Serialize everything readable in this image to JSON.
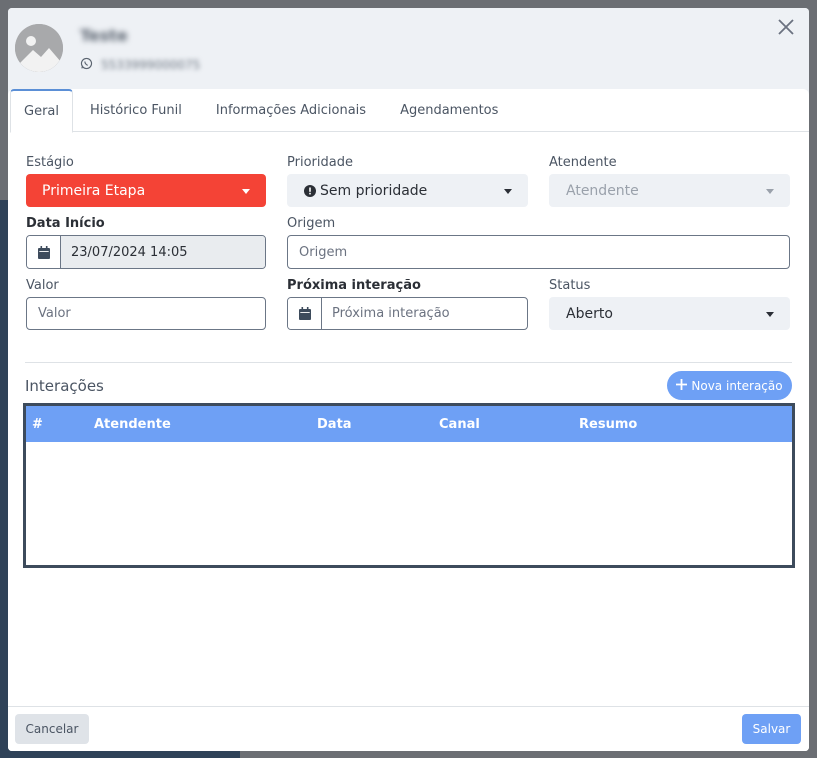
{
  "contact": {
    "name": "Teste",
    "phone": "5533999000075"
  },
  "tabs": [
    {
      "label": "Geral",
      "active": true
    },
    {
      "label": "Histórico Funil",
      "active": false
    },
    {
      "label": "Informações Adicionais",
      "active": false
    },
    {
      "label": "Agendamentos",
      "active": false
    }
  ],
  "form": {
    "estagio": {
      "label": "Estágio",
      "value": "Primeira Etapa"
    },
    "prioridade": {
      "label": "Prioridade",
      "value": "Sem prioridade"
    },
    "atendente": {
      "label": "Atendente",
      "placeholder": "Atendente"
    },
    "data_inicio": {
      "label": "Data Início",
      "value": "23/07/2024 14:05"
    },
    "origem": {
      "label": "Origem",
      "placeholder": "Origem"
    },
    "valor": {
      "label": "Valor",
      "placeholder": "Valor"
    },
    "proxima_interacao": {
      "label": "Próxima interação",
      "placeholder": "Próxima interação"
    },
    "status": {
      "label": "Status",
      "value": "Aberto"
    }
  },
  "interactions": {
    "title": "Interações",
    "new_button": "Nova interação",
    "columns": [
      "#",
      "Atendente",
      "Data",
      "Canal",
      "Resumo"
    ],
    "rows": []
  },
  "footer": {
    "cancel": "Cancelar",
    "save": "Salvar"
  },
  "colors": {
    "primary": "#6ea0f5",
    "stage_red": "#f44336",
    "table_border": "#3d4b5c"
  },
  "icons": [
    "user-avatar-icon",
    "whatsapp-icon",
    "close-icon",
    "exclamation-circle-icon",
    "calendar-icon",
    "plus-icon",
    "caret-down-icon"
  ]
}
